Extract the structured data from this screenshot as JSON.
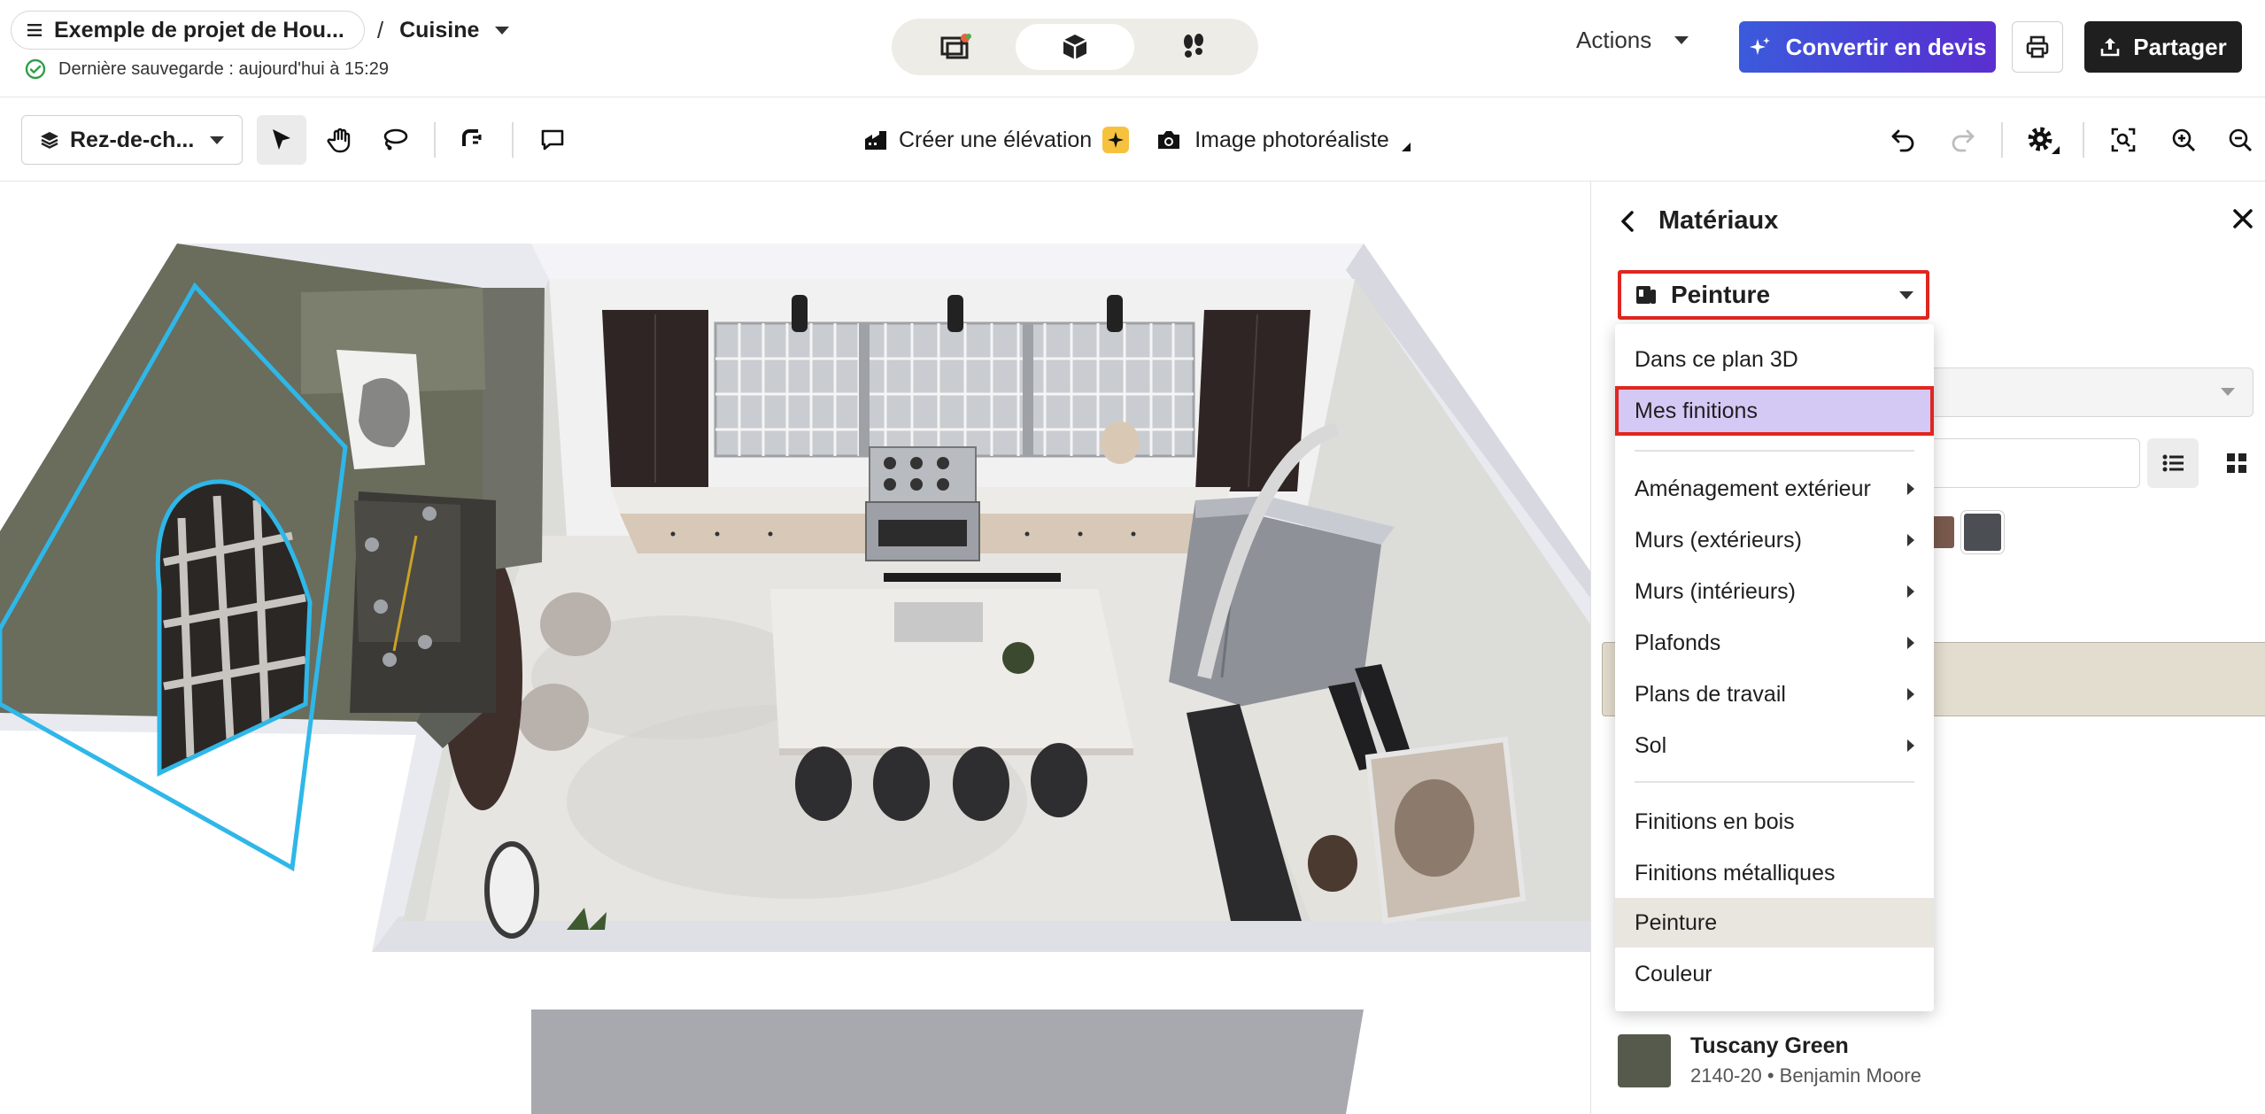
{
  "header": {
    "project_name": "Exemple de projet de Hou...",
    "separator": "/",
    "room_name": "Cuisine",
    "save_status": "Dernière sauvegarde : aujourd'hui à 15:29",
    "actions_label": "Actions",
    "convert_label": "Convertir en devis",
    "share_label": "Partager"
  },
  "toolbar": {
    "level_label": "Rez-de-ch...",
    "create_elevation_label": "Créer une élévation",
    "photo_label": "Image photoréaliste"
  },
  "panel": {
    "title": "Matériaux",
    "category_selected": "Peinture",
    "menu": {
      "items": [
        {
          "label": "Dans ce plan 3D",
          "submenu": false
        },
        {
          "label": "Mes finitions",
          "submenu": false
        },
        {
          "label": "Aménagement extérieur",
          "submenu": true
        },
        {
          "label": "Murs (extérieurs)",
          "submenu": true
        },
        {
          "label": "Murs (intérieurs)",
          "submenu": true
        },
        {
          "label": "Plafonds",
          "submenu": true
        },
        {
          "label": "Plans de travail",
          "submenu": true
        },
        {
          "label": "Sol",
          "submenu": true
        },
        {
          "label": "Finitions en bois",
          "submenu": false
        },
        {
          "label": "Finitions métalliques",
          "submenu": false
        },
        {
          "label": "Peinture",
          "submenu": false
        },
        {
          "label": "Couleur",
          "submenu": false
        }
      ]
    },
    "result": {
      "name": "Tuscany Green",
      "detail": "2140-20 • Benjamin Moore",
      "swatch_color": "#555a4c"
    }
  },
  "colors": {
    "accent": "#4c3ed6",
    "highlight_border": "#e0271f",
    "menu_highlight": "#d4c9f5",
    "selection_outline": "#2fb7e8"
  }
}
